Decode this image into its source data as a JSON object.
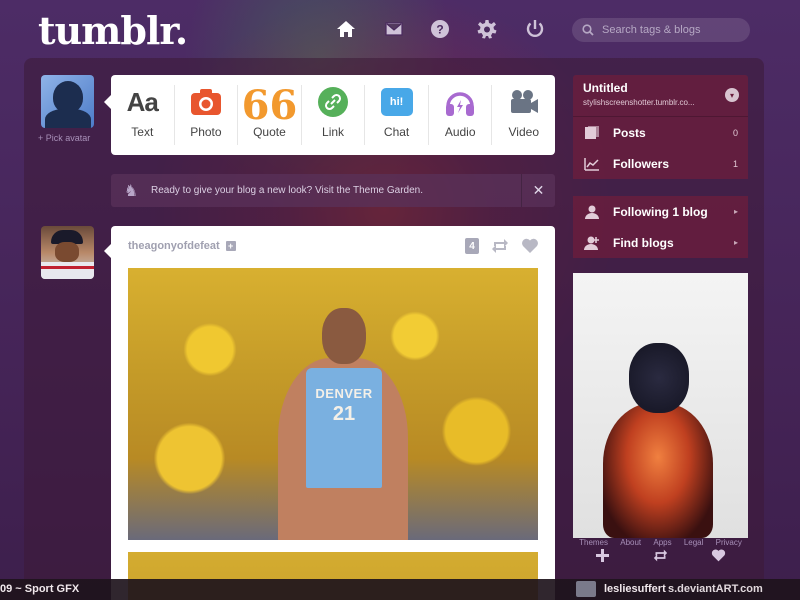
{
  "header": {
    "logo": "tumblr.",
    "search_placeholder": "Search tags & blogs",
    "nav_icons": [
      "home-icon",
      "mail-icon",
      "help-icon",
      "gear-icon",
      "power-icon"
    ]
  },
  "avatar": {
    "label": "+ Pick avatar"
  },
  "post_types": [
    {
      "label": "Text",
      "icon": "text-icon",
      "glyph": "Aa",
      "color": "#444444"
    },
    {
      "label": "Photo",
      "icon": "camera-icon",
      "color": "#e8562e"
    },
    {
      "label": "Quote",
      "icon": "quote-icon",
      "glyph": "66",
      "color": "#f2992e"
    },
    {
      "label": "Link",
      "icon": "link-icon",
      "color": "#56b05a"
    },
    {
      "label": "Chat",
      "icon": "chat-icon",
      "glyph": "hi!",
      "color": "#48a8e8"
    },
    {
      "label": "Audio",
      "icon": "headphones-icon",
      "color": "#a86ad0"
    },
    {
      "label": "Video",
      "icon": "video-camera-icon",
      "color": "#7a8494"
    }
  ],
  "notice": {
    "text": "Ready to give your blog a new look? Visit the Theme Garden.",
    "close": "✕"
  },
  "post": {
    "username": "theagonyofdefeat",
    "follow": "+",
    "notes": "4",
    "jersey_team": "DENVER",
    "jersey_number": "21"
  },
  "sidebar": {
    "blog_title": "Untitled",
    "blog_url": "stylishscreenshotter.tumblr.co...",
    "toggle": "▾",
    "rows": [
      {
        "label": "Posts",
        "count": "0",
        "icon": "posts-icon"
      },
      {
        "label": "Followers",
        "count": "1",
        "icon": "followers-icon"
      }
    ],
    "links": [
      {
        "label": "Following 1 blog",
        "arrow": "▸",
        "icon": "user-icon"
      },
      {
        "label": "Find blogs",
        "arrow": "▸",
        "icon": "add-user-icon"
      }
    ],
    "radar_links": [
      "Themes",
      "About",
      "Apps",
      "Legal",
      "Privacy"
    ]
  },
  "bottom": {
    "left": "09 ~ Sport GFX",
    "user": "lesliesuffert",
    "watermark": "s.deviantART.com"
  }
}
